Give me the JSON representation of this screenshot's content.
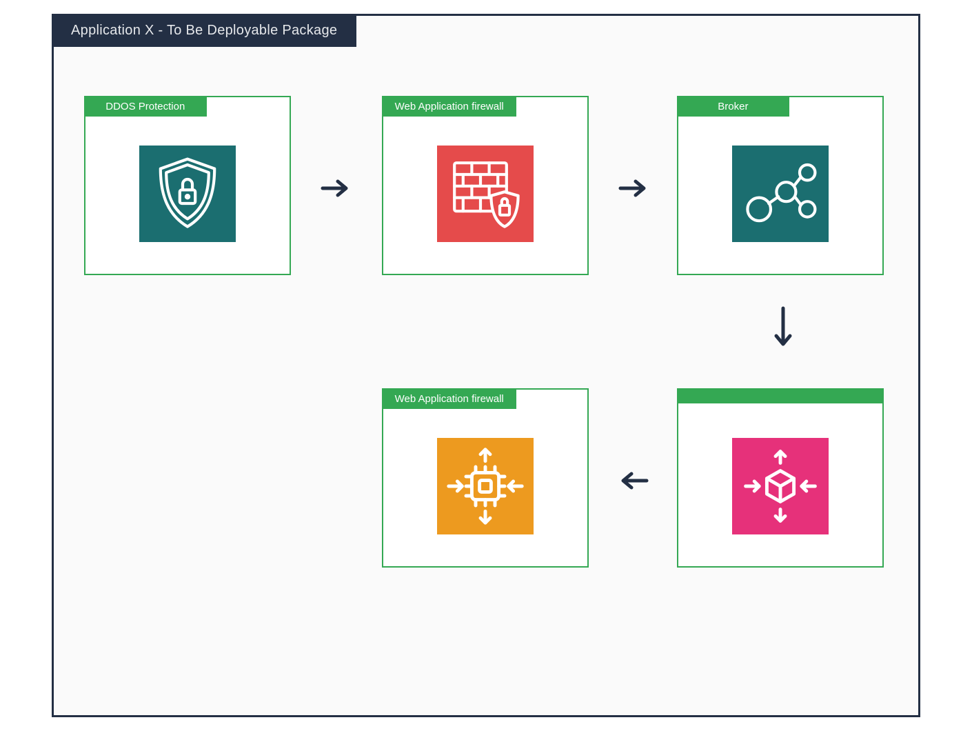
{
  "diagram": {
    "title": "Application X - To Be Deployable Package",
    "cards": {
      "ddos": {
        "label": "DDOS Protection",
        "icon": "shield-lock-icon",
        "iconBg": "#1b6e70"
      },
      "waf1": {
        "label": "Web Application firewall",
        "icon": "firewall-icon",
        "iconBg": "#e54b4b"
      },
      "broker": {
        "label": "Broker",
        "icon": "network-nodes-icon",
        "iconBg": "#1b6e70"
      },
      "dist": {
        "label": "",
        "icon": "package-distribute-icon",
        "iconBg": "#e6317a"
      },
      "waf2": {
        "label": "Web Application firewall",
        "icon": "chip-distribute-icon",
        "iconBg": "#ed9a1f"
      }
    },
    "flow": [
      {
        "from": "ddos",
        "to": "waf1",
        "dir": "right"
      },
      {
        "from": "waf1",
        "to": "broker",
        "dir": "right"
      },
      {
        "from": "broker",
        "to": "dist",
        "dir": "down"
      },
      {
        "from": "dist",
        "to": "waf2",
        "dir": "left"
      }
    ],
    "colors": {
      "frame": "#232f44",
      "cardBorder": "#34a853",
      "arrow": "#232f44"
    }
  }
}
